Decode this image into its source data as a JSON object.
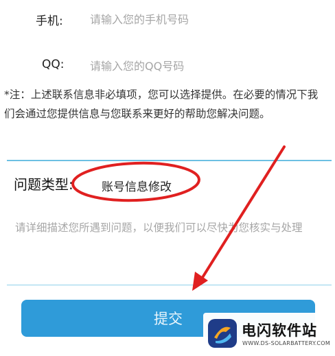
{
  "contact": {
    "phone_label": "手机:",
    "phone_placeholder": "请输入您的手机号码",
    "qq_label": "QQ:",
    "qq_placeholder": "请输入您的QQ号码",
    "note": "*注：上述联系信息非必填项，您可以选择提供。在必要的情况下我们会通过您提供信息与您联系来更好的帮助您解决问题。"
  },
  "issue": {
    "type_label": "问题类型:",
    "type_value": "账号信息修改",
    "description_placeholder": "请详细描述您所遇到问题，以便我们可以尽快为您核实与处理"
  },
  "submit_label": "提交",
  "watermark": {
    "name": "电闪软件站",
    "url": "WWW.DS-SOLARBATTERY.COM"
  },
  "colors": {
    "accent": "#2f9bd9",
    "divider": "#6cc0e3",
    "annotation": "#e02020"
  }
}
